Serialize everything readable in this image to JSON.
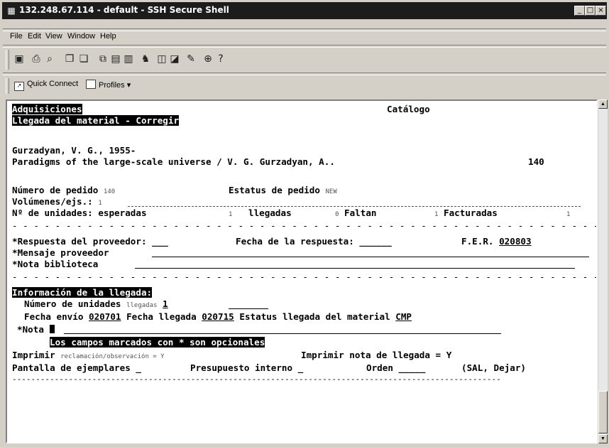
{
  "window": {
    "title": "132.248.67.114 - default - SSH Secure Shell",
    "controls": [
      "_",
      "□",
      "×"
    ]
  },
  "menu": {
    "items": [
      "File",
      "Edit",
      "View",
      "Window",
      "Help"
    ]
  },
  "toolbar": {
    "icons": [
      "save-icon",
      "print-icon",
      "print-preview-icon",
      "copy-icon",
      "paste-icon",
      "find-icon",
      "settings-icon",
      "help-icon"
    ]
  },
  "quickbar": {
    "quick_connect": "Quick Connect",
    "profiles": "Profiles ▾"
  },
  "terminal": {
    "module": "Adquisiciones",
    "catalog": "Catálogo",
    "screen_title": "Llegada del material - Corregir",
    "author": "Gurzadyan, V. G., 1955-",
    "title_line": "Paradigms of the large-scale universe / V. G. Gurzadyan, A..",
    "record_num": "140",
    "order_label": "Número de pedido",
    "order_value": "140",
    "status_label": "Estatus de pedido",
    "status_value": "NEW",
    "vol_label": "Volúmenes/ejs.:",
    "vol_value": "1",
    "units_label": "Nº de unidades: esperadas",
    "expected": "1",
    "arrived_label": "llegadas",
    "arrived": "0",
    "missing_label": "Faltan",
    "missing": "1",
    "invoiced_label": "Facturadas",
    "invoiced": "1",
    "dashes": "- - - - - - - - - - - - - - - - - - - - - - - - - - - - - - - - - - - - - - - - - - - - - - - - - - - - - - - - - - - -",
    "provider_resp": "*Respuesta del proveedor: ___",
    "resp_date": "Fecha de la respuesta: ______",
    "fer_label": "F.E.R.",
    "fer_value": "020803",
    "provider_msg": "*Mensaje proveedor",
    "library_note": "*Nota biblioteca",
    "arrival_info": "Información de la llegada:",
    "units_num_label": "Número de unidades",
    "units_num_hint": "llegadas",
    "units_num_value": "1",
    "ship_date_label": "Fecha envío",
    "ship_date": "020701",
    "arrival_date_label": "Fecha llegada",
    "arrival_date": "020715",
    "material_status_label": "Estatus llegada del material",
    "material_status": "CMP",
    "note_label": "*Nota",
    "optional_msg": "Los campos marcados con * son opcionales",
    "print_label": "Imprimir",
    "print_hint": "reclamación/observación = Y",
    "print_note": "Imprimir nota de llegada = Y",
    "copies_screen": "Pantalla de ejemplares _",
    "budget": "Presupuesto interno _",
    "order_label2": "Orden _____",
    "order_opts": "(SAL, Dejar)",
    "bottom_dashes": "--------------------------------------------------------------------------------------------------------"
  }
}
